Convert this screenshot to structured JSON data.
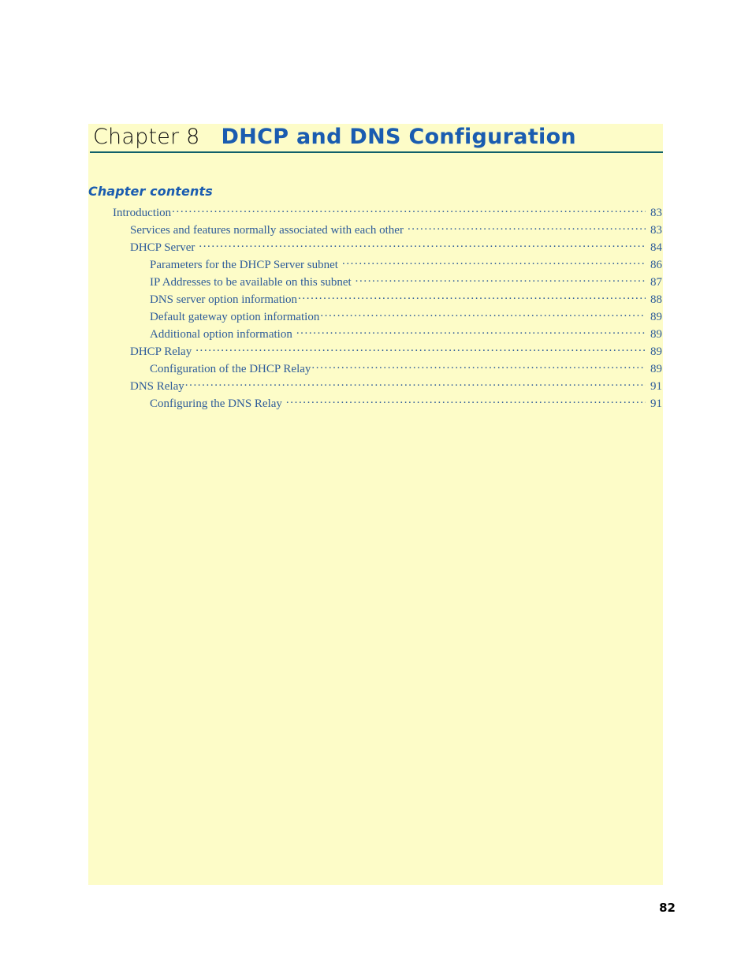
{
  "chapter": {
    "label": "Chapter 8",
    "title": "DHCP and DNS Configuration"
  },
  "contents": {
    "heading": "Chapter contents",
    "entries": [
      {
        "label": "Introduction",
        "page": "83",
        "level": 1,
        "gap": false
      },
      {
        "label": "Services and features normally associated with each other",
        "page": "83",
        "level": 2,
        "gap": true
      },
      {
        "label": "DHCP Server",
        "page": "84",
        "level": 2,
        "gap": true
      },
      {
        "label": "Parameters for the DHCP Server subnet",
        "page": "86",
        "level": 3,
        "gap": true
      },
      {
        "label": "IP Addresses to be available on this subnet",
        "page": "87",
        "level": 3,
        "gap": true
      },
      {
        "label": "DNS server option information",
        "page": "88",
        "level": 3,
        "gap": false
      },
      {
        "label": "Default gateway option information",
        "page": "89",
        "level": 3,
        "gap": false
      },
      {
        "label": "Additional option information",
        "page": "89",
        "level": 3,
        "gap": true
      },
      {
        "label": "DHCP Relay",
        "page": "89",
        "level": 2,
        "gap": true
      },
      {
        "label": "Configuration of the DHCP Relay",
        "page": "89",
        "level": 3,
        "gap": false
      },
      {
        "label": "DNS Relay",
        "page": "91",
        "level": 2,
        "gap": false
      },
      {
        "label": "Configuring the DNS Relay",
        "page": "91",
        "level": 3,
        "gap": true
      }
    ]
  },
  "folio": {
    "page_number": "82"
  },
  "colors": {
    "panel_background": "#fdfcc8",
    "title_blue": "#1a5cb0",
    "toc_blue": "#2e5c9a",
    "rule_teal": "#10606a",
    "folio_black": "#000000"
  }
}
